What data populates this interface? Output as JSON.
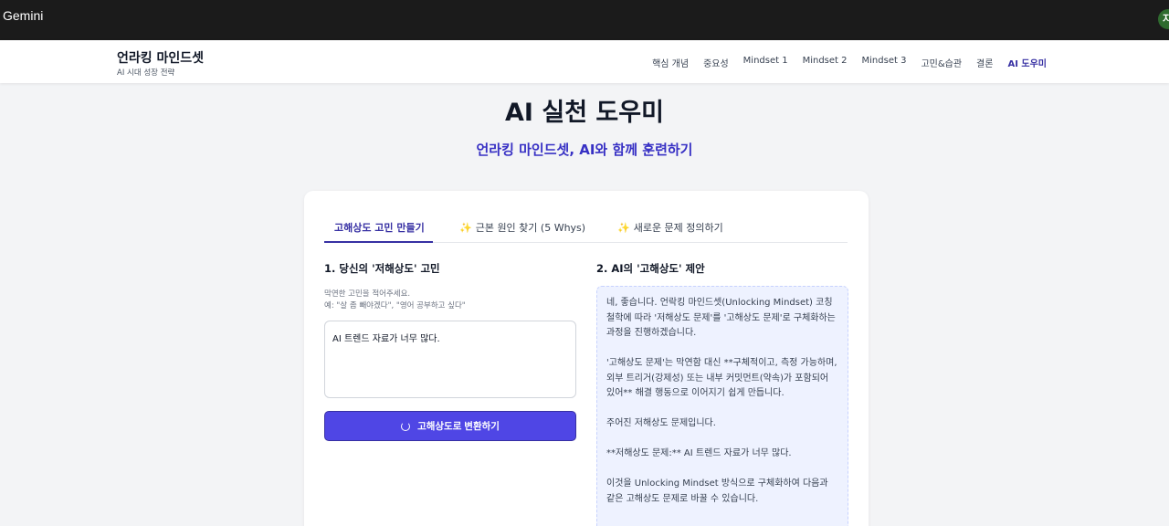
{
  "browser": {
    "app_name": "Gemini",
    "avatar_initial": "지"
  },
  "header": {
    "title": "언라킹 마인드셋",
    "subtitle": "AI 시대 성장 전략",
    "nav": [
      "핵심 개념",
      "중요성",
      "Mindset 1",
      "Mindset 2",
      "Mindset 3",
      "고민&습관",
      "결론",
      "AI 도우미"
    ],
    "active_nav": "AI 도우미"
  },
  "hero": {
    "title": "AI 실천 도우미",
    "subtitle": "언라킹 마인드셋, AI와 함께 훈련하기"
  },
  "tabs": [
    {
      "label": "고해상도 고민 만들기",
      "icon": ""
    },
    {
      "label": "근본 원인 찾기 (5 Whys)",
      "icon": "sparkle-icon"
    },
    {
      "label": "새로운 문제 정의하기",
      "icon": "sparkle-icon"
    }
  ],
  "input_section": {
    "heading": "1. 당신의 '저해상도' 고민",
    "hint_line1": "막연한 고민을 적어주세요.",
    "hint_line2": "예: \"살 좀 빼야겠다\", \"영어 공부하고 싶다\"",
    "value": "AI 트렌드 자료가 너무 많다.",
    "button_label": "고해상도로 변환하기"
  },
  "output_section": {
    "heading": "2. AI의 '고해상도' 제안",
    "paragraphs": [
      "네, 좋습니다. 언락킹 마인드셋(Unlocking Mindset) 코칭 철학에 따라 '저해상도 문제'를 '고해상도 문제'로 구체화하는 과정을 진행하겠습니다.",
      "'고해상도 문제'는 막연함 대신 **구체적이고, 측정 가능하며, 외부 트리거(강제성) 또는 내부 커밋먼트(약속)가 포함되어 있어** 해결 행동으로 이어지기 쉽게 만듭니다.",
      "주어진 저해상도 문제입니다.",
      "**저해상도 문제:** AI 트렌드 자료가 너무 많다.",
      "이것을 Unlocking Mindset 방식으로 구체화하여 다음과 같은 고해상도 문제로 바꿀 수 있습니다."
    ]
  },
  "colors": {
    "accent": "#3730a3",
    "button": "#4f46e5",
    "hero_subtitle": "#3730c4",
    "topbar": "#1b1b1b"
  }
}
